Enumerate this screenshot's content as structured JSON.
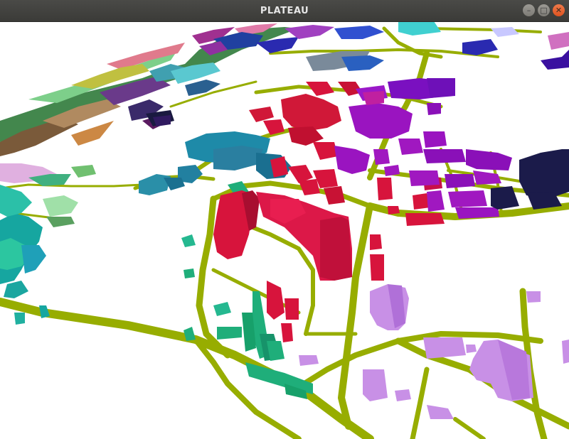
{
  "window": {
    "title": "PLATEAU",
    "controls": {
      "minimize_icon": "minimize-icon",
      "maximize_icon": "maximize-icon",
      "close_icon": "close-icon"
    }
  },
  "colors": {
    "titlebar": "#3c3b37",
    "road": "#97ad00",
    "close_button": "#e95420",
    "district_red": "#d7143c",
    "district_purple": "#8a10b8",
    "district_navy": "#1b1b4a",
    "district_teal": "#2a8aa6",
    "district_green": "#1fae7a",
    "district_lilac": "#c890e6"
  }
}
